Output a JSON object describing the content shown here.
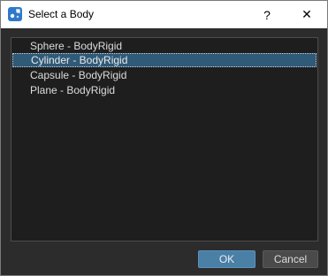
{
  "window": {
    "title": "Select a Body",
    "help_glyph": "?",
    "close_glyph": "✕"
  },
  "list": {
    "items": [
      {
        "label": "Sphere - BodyRigid",
        "selected": false
      },
      {
        "label": "Cylinder - BodyRigid",
        "selected": true
      },
      {
        "label": "Capsule - BodyRigid",
        "selected": false
      },
      {
        "label": "Plane - BodyRigid",
        "selected": false
      }
    ]
  },
  "buttons": {
    "ok_label": "OK",
    "cancel_label": "Cancel"
  },
  "colors": {
    "accent": "#4a7fa6",
    "selection": "#2f5a78",
    "background": "#2c2c2c",
    "list_background": "#1e1e1e"
  },
  "icons": {
    "app": "app-icon",
    "help": "help-icon",
    "close": "close-icon"
  }
}
